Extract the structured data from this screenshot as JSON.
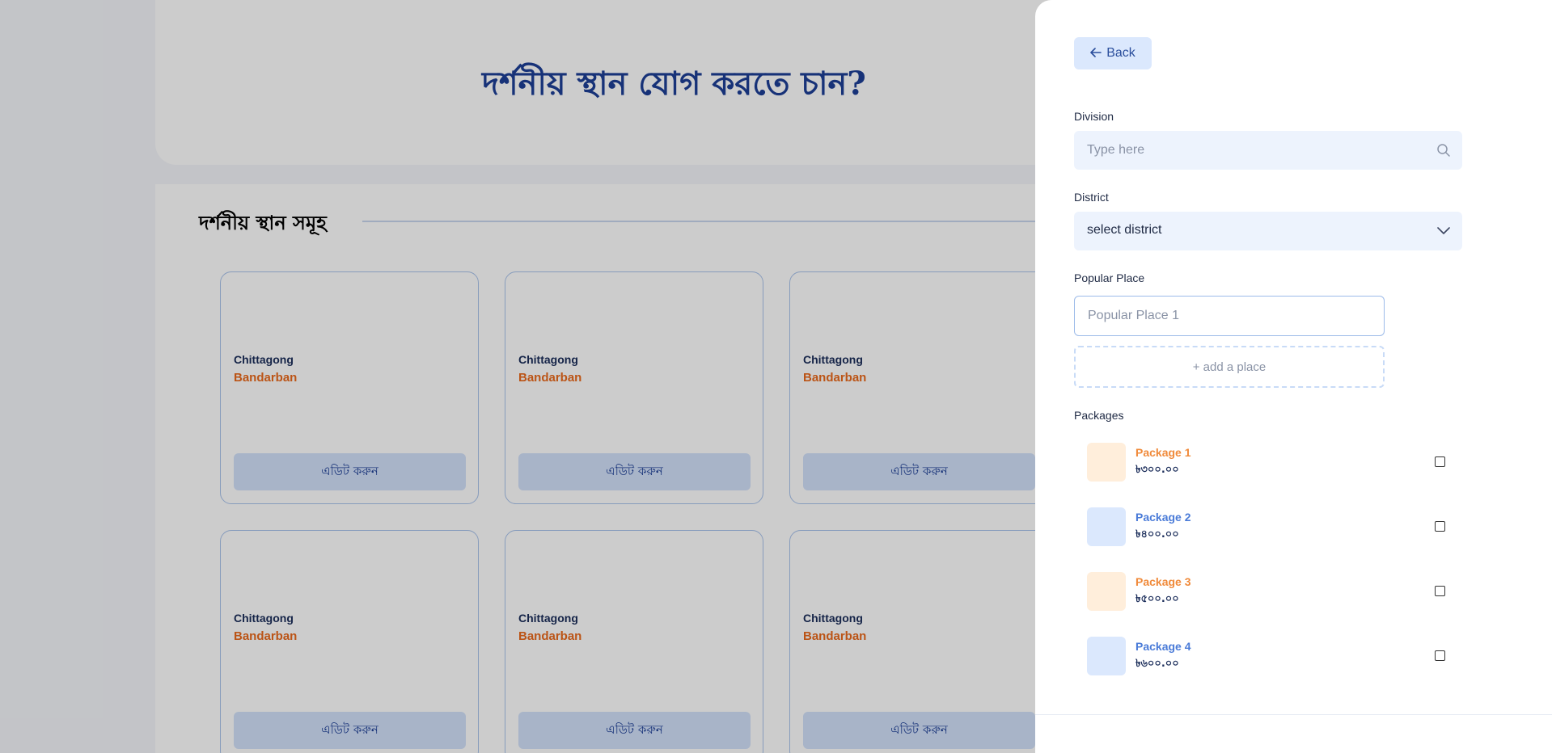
{
  "hero": {
    "title": "দর্শনীয় স্থান যোগ করতে চান?"
  },
  "section": {
    "title": "দর্শনীয় স্থান সমূহ"
  },
  "cards": [
    {
      "division": "Chittagong",
      "district": "Bandarban",
      "button": "এডিট করুন"
    },
    {
      "division": "Chittagong",
      "district": "Bandarban",
      "button": "এডিট করুন"
    },
    {
      "division": "Chittagong",
      "district": "Bandarban",
      "button": "এডিট করুন"
    },
    {
      "division": "Chittagong",
      "district": "Bandarban",
      "button": "এডিট করুন"
    },
    {
      "division": "Chittagong",
      "district": "Bandarban",
      "button": "এডিট করুন"
    },
    {
      "division": "Chittagong",
      "district": "Bandarban",
      "button": "এডিট করুন"
    }
  ],
  "drawer": {
    "back_label": "Back",
    "division": {
      "label": "Division",
      "placeholder": "Type here",
      "icon": "search-icon"
    },
    "district": {
      "label": "District",
      "value": "select district",
      "icon": "chevron-down-icon"
    },
    "popular_place": {
      "label": "Popular Place",
      "placeholder": "Popular Place 1",
      "add_label": "+ add a place"
    },
    "packages": {
      "label": "Packages",
      "items": [
        {
          "name": "Package 1",
          "price": "৳৩০০.০০",
          "checked": false
        },
        {
          "name": "Package 2",
          "price": "৳৪০০.০০",
          "checked": false
        },
        {
          "name": "Package 3",
          "price": "৳৫০০.০০",
          "checked": false
        },
        {
          "name": "Package 4",
          "price": "৳৬০০.০০",
          "checked": false
        }
      ]
    }
  },
  "colors": {
    "brand_blue": "#1d3f97",
    "accent_orange": "#ea6a1c",
    "package_orange": "#f08a3a",
    "package_blue": "#4a7bd8",
    "thumb_orange": "#ffeedb",
    "thumb_blue": "#dbe8fd"
  }
}
